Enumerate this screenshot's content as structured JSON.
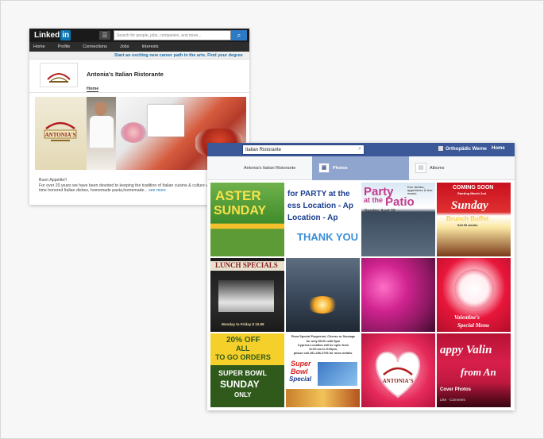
{
  "linkedin": {
    "logo": "in",
    "search_placeholder": "Search for people, jobs, companies, and more...",
    "nav": [
      "Home",
      "Profile",
      "Connections",
      "Jobs",
      "Interests"
    ],
    "promo": "Start an exciting new career path in the arts. Find your degree",
    "company_name": "Antonia's Italian Ristorante",
    "tab": "Home",
    "greeting": "Buon Appetito!!",
    "description": "For over 20 years we have been devoted to keeping the tradition of Italian cuisine & culture vibrant & alive with time honored Italian dishes, homemade pasta,homemade...",
    "see_more": "see more",
    "logo_text": "ANTONIA'S",
    "brand_color": "#0a77b5"
  },
  "facebook": {
    "search_value": "Italian Ristorante",
    "user_name": "Orthopädic Werne",
    "home": "Home",
    "tabs": [
      "Antonia's Italian Ristorante",
      "Photos",
      "Albums"
    ],
    "brand_color": "#3b5998",
    "tiles": {
      "easter": [
        "ASTER",
        "SUNDAY"
      ],
      "party": [
        "for PARTY at the",
        "ess Location - Ap",
        "Location  - Ap",
        "THANK YOU"
      ],
      "patio": [
        "Party",
        "at the",
        "Patio",
        "free drinks, appetizers & live music",
        "Sunday, April 20"
      ],
      "brunch": [
        "COMING SOON",
        "Starting March 2nd",
        "Sunday",
        "Brunch Buffet",
        "$15.95 Adults"
      ],
      "lunch": [
        "LUNCH SPECIALS",
        "Monday to Friday $ 10.99"
      ],
      "valentine": [
        "Valentine's",
        "Special Menu"
      ],
      "togo": [
        "20% OFF",
        "ALL",
        "TO GO ORDERS",
        "SUPER BOWL",
        "SUNDAY",
        "ONLY"
      ],
      "pizza": [
        "Pizza Special Pepperoni, Cheese or Sausage",
        "for only $5.00 until 5pm",
        "Cypress Location will be open from",
        "11:00 am to 5:00pm,",
        "please call 281-256-2796 for more details.",
        "Super",
        "Bowl",
        "Special"
      ],
      "heart": [
        "ANTONIA'S"
      ],
      "happyval": [
        "appy Valin",
        "from An",
        "Cover Photos",
        "Like · Comment"
      ]
    }
  }
}
